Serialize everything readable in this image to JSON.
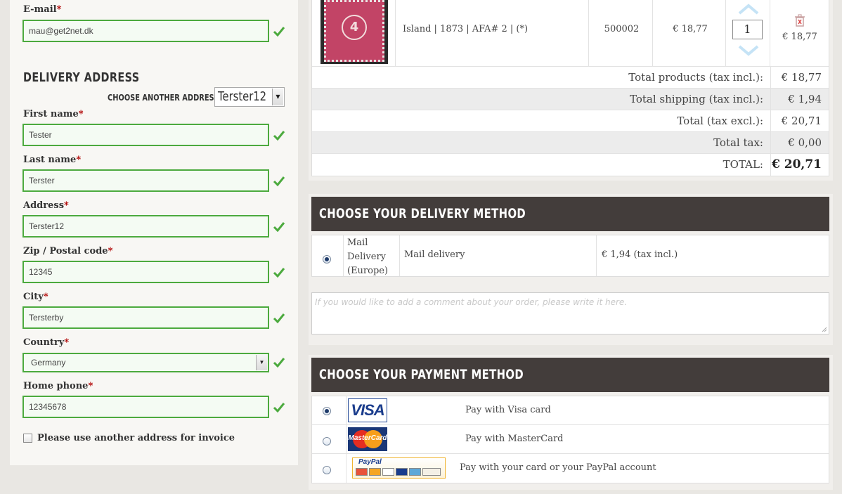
{
  "account": {
    "email_label": "E-mail",
    "email_value": "mau@get2net.dk"
  },
  "delivery_address": {
    "section_title": "DELIVERY ADDRESS",
    "choose_label": "CHOOSE ANOTHER ADDRESS:",
    "choose_value": "Terster12",
    "fields": {
      "first_name": {
        "label": "First name",
        "value": "Tester"
      },
      "last_name": {
        "label": "Last name",
        "value": "Terster"
      },
      "address": {
        "label": "Address",
        "value": "Terster12"
      },
      "zip": {
        "label": "Zip / Postal code",
        "value": "12345"
      },
      "city": {
        "label": "City",
        "value": "Tersterby"
      },
      "country": {
        "label": "Country",
        "value": "Germany"
      },
      "home_phone": {
        "label": "Home phone",
        "value": "12345678"
      }
    },
    "required_mark": "*",
    "invoice_checkbox_label": "Please use another address for invoice"
  },
  "cart": {
    "product": {
      "stamp_number": "4",
      "description": "Island | 1873 | AFA# 2 | (*)",
      "reference": "500002",
      "unit_price": "€ 18,77",
      "quantity": "1",
      "total": "€ 18,77"
    },
    "summary": [
      {
        "label": "Total products (tax incl.):",
        "value": "€ 18,77"
      },
      {
        "label": "Total shipping (tax incl.):",
        "value": "€ 1,94"
      },
      {
        "label": "Total (tax excl.):",
        "value": "€ 20,71"
      },
      {
        "label": "Total tax:",
        "value": "€ 0,00"
      },
      {
        "label": "TOTAL:",
        "value": "€ 20,71"
      }
    ]
  },
  "delivery_method": {
    "title": "CHOOSE YOUR DELIVERY METHOD",
    "carrier_name": "Mail Delivery (Europe)",
    "carrier_desc": "Mail delivery",
    "carrier_price": "€ 1,94 (tax incl.)",
    "comment_placeholder": "If you would like to add a comment about your order, please write it here."
  },
  "payment_method": {
    "title": "CHOOSE YOUR PAYMENT METHOD",
    "options": [
      {
        "logo": "VISA",
        "label": "Pay with Visa card",
        "selected": true
      },
      {
        "logo": "MasterCard",
        "label": "Pay with MasterCard",
        "selected": false
      },
      {
        "logo": "PayPal",
        "label": "Pay with your card or your PayPal account",
        "selected": false
      }
    ]
  },
  "colors": {
    "valid_border": "#4caa3e",
    "header_bg": "#433d3b",
    "required": "#b00000"
  }
}
